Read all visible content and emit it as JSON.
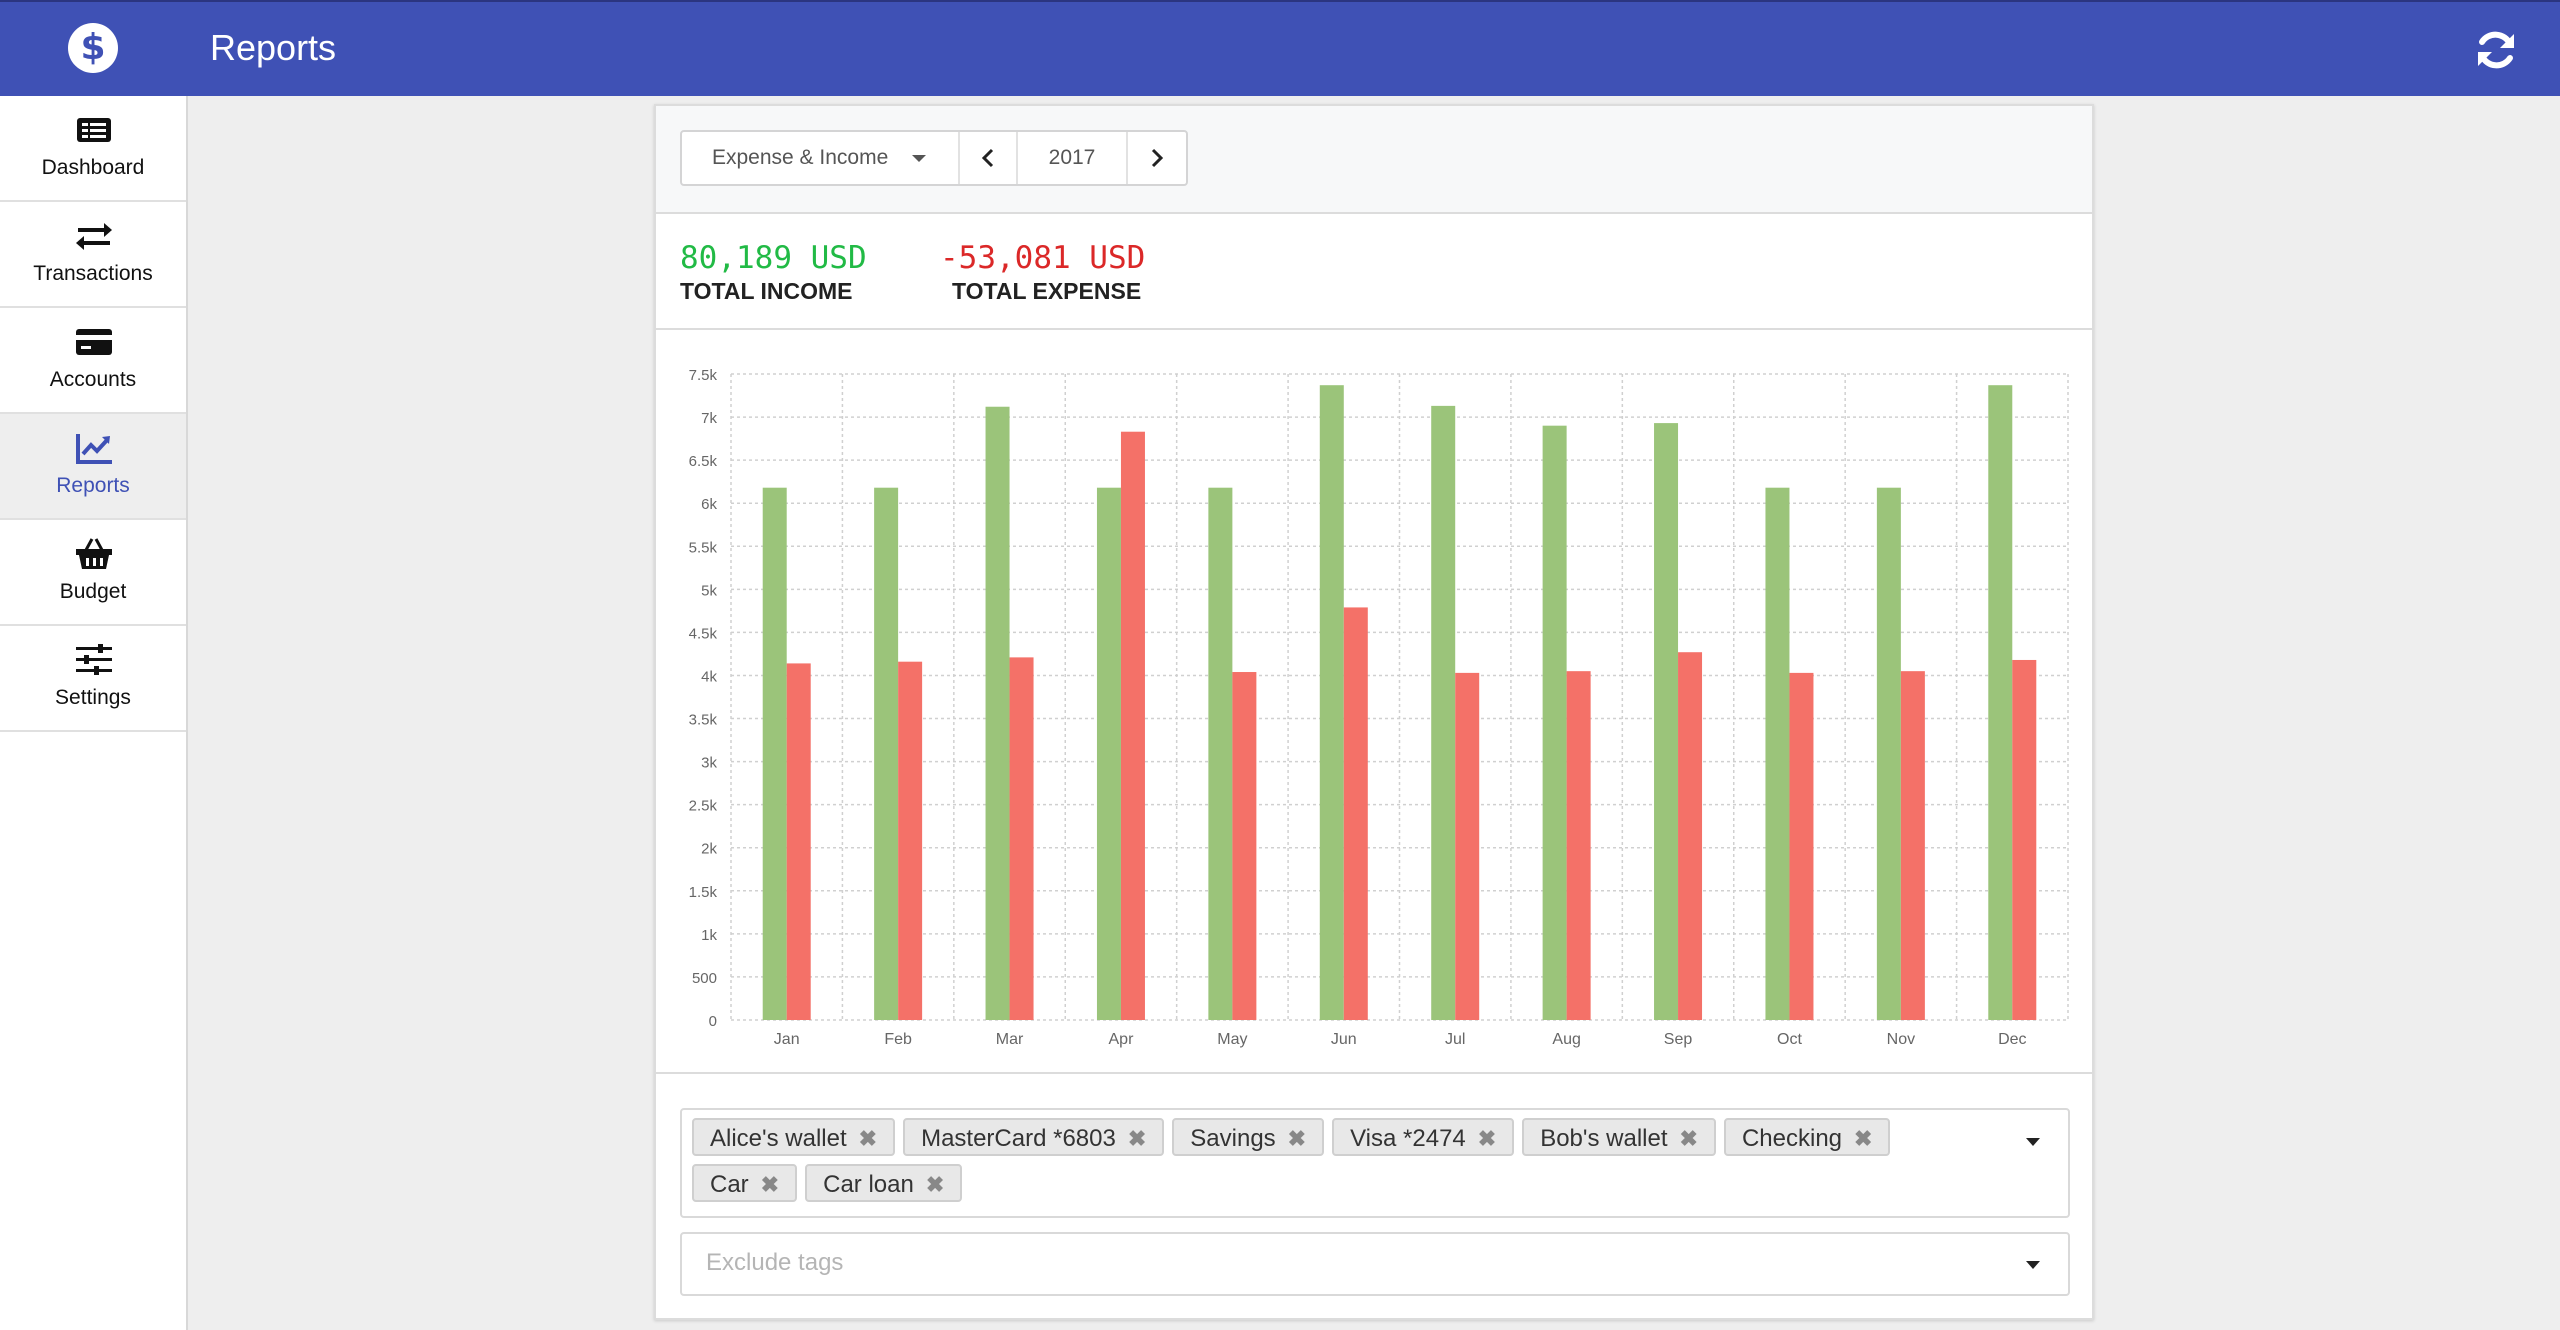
{
  "header": {
    "logo": "$",
    "title": "Reports"
  },
  "sidebar": {
    "items": [
      {
        "label": "Dashboard",
        "icon": "dashboard-icon",
        "active": false
      },
      {
        "label": "Transactions",
        "icon": "exchange-icon",
        "active": false
      },
      {
        "label": "Accounts",
        "icon": "credit-card-icon",
        "active": false
      },
      {
        "label": "Reports",
        "icon": "line-chart-icon",
        "active": true
      },
      {
        "label": "Budget",
        "icon": "basket-icon",
        "active": false
      },
      {
        "label": "Settings",
        "icon": "sliders-icon",
        "active": false
      }
    ]
  },
  "toolbar": {
    "mode": "Expense & Income",
    "year": "2017"
  },
  "totals": {
    "income_value": "80,189 USD",
    "income_label": "TOTAL INCOME",
    "expense_value": "-53,081 USD",
    "expense_label": "TOTAL EXPENSE"
  },
  "colors": {
    "primary": "#3f51b5",
    "income": "#21ba45",
    "expense": "#db2828",
    "income_bar": "#9bc47a",
    "expense_bar": "#f47168"
  },
  "chart_data": {
    "type": "bar",
    "categories": [
      "Jan",
      "Feb",
      "Mar",
      "Apr",
      "May",
      "Jun",
      "Jul",
      "Aug",
      "Sep",
      "Oct",
      "Nov",
      "Dec"
    ],
    "series": [
      {
        "values": [
          6180,
          6180,
          7120,
          6180,
          6180,
          7370,
          7130,
          6900,
          6930,
          6180,
          6180,
          7370
        ]
      },
      {
        "values": [
          4140,
          4160,
          4210,
          6830,
          4040,
          4790,
          4030,
          4050,
          4270,
          4030,
          4050,
          4180
        ]
      }
    ],
    "yticks": [
      "0",
      "500",
      "1k",
      "1.5k",
      "2k",
      "2.5k",
      "3k",
      "3.5k",
      "4k",
      "4.5k",
      "5k",
      "5.5k",
      "6k",
      "6.5k",
      "7k",
      "7.5k"
    ],
    "ylim": [
      0,
      7500
    ],
    "grid": true
  },
  "filters": {
    "accounts": [
      "Alice's wallet",
      "MasterCard *6803",
      "Savings",
      "Visa *2474",
      "Bob's wallet",
      "Checking",
      "Car",
      "Car loan"
    ],
    "chip_remove": "✖",
    "tags_placeholder": "Exclude tags"
  }
}
